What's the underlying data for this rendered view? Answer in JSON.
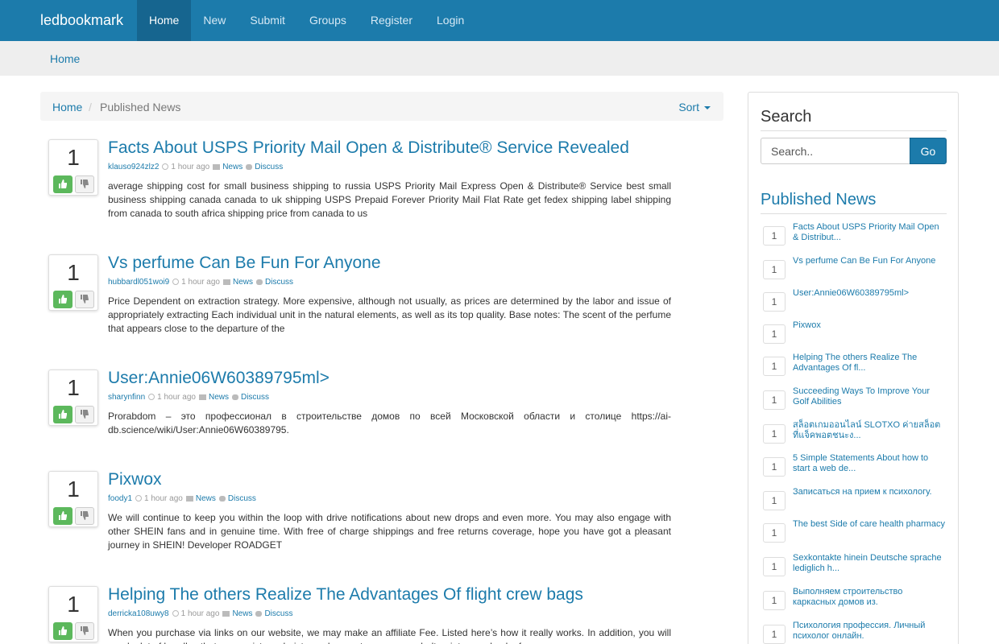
{
  "navbar": {
    "brand": "ledbookmark",
    "items": [
      {
        "label": "Home",
        "active": true
      },
      {
        "label": "New"
      },
      {
        "label": "Submit"
      },
      {
        "label": "Groups"
      },
      {
        "label": "Register"
      },
      {
        "label": "Login"
      }
    ]
  },
  "jumbotron": {
    "home_link": "Home"
  },
  "breadcrumb": {
    "home": "Home",
    "separator": "/",
    "current": "Published News",
    "sort_label": "Sort"
  },
  "posts": [
    {
      "votes": "1",
      "title": "Facts About USPS Priority Mail Open & Distribute® Service Revealed",
      "author": "klauso924zlz2",
      "time": "1 hour ago",
      "category": "News",
      "discuss": "Discuss",
      "body": "average shipping cost for small business shipping to russia USPS Priority Mail Express Open & Distribute® Service best small business shipping canada canada to uk shipping USPS Prepaid Forever Priority Mail Flat Rate get fedex shipping label shipping from canada to south africa shipping price from canada to us"
    },
    {
      "votes": "1",
      "title": "Vs perfume Can Be Fun For Anyone",
      "author": "hubbardl051woi9",
      "time": "1 hour ago",
      "category": "News",
      "discuss": "Discuss",
      "body": "Price Dependent on extraction strategy. More expensive, although not usually, as prices are determined by the labor and issue of appropriately extracting Each individual unit in the natural elements, as well as its top quality. Base notes: The scent of the perfume that appears close to the departure of the"
    },
    {
      "votes": "1",
      "title": "User:Annie06W60389795ml>",
      "author": "sharynfinn",
      "time": "1 hour ago",
      "category": "News",
      "discuss": "Discuss",
      "body": "Prorabdom – это профессионал в строительстве домов по всей Московской области и столице https://ai-db.science/wiki/User:Annie06W60389795."
    },
    {
      "votes": "1",
      "title": "Pixwox",
      "author": "foody1",
      "time": "1 hour ago",
      "category": "News",
      "discuss": "Discuss",
      "body": "We will continue to keep you within the loop with drive notifications about new drops and even more. You may also engage with other SHEIN fans and in genuine time. With free of charge shippings and free returns coverage, hope you have got a pleasant journey in SHEIN! Developer ROADGET"
    },
    {
      "votes": "1",
      "title": "Helping The others Realize The Advantages Of flight crew bags",
      "author": "derricka108uwy8",
      "time": "1 hour ago",
      "category": "News",
      "discuss": "Discuss",
      "body": "When you purchase via links on our website, we may make an affiliate Fee. Listed here’s how it really works. In addition, you will need a lot of handles that can assist you hoist your bag on to a conveyor belt or into your back of a car or"
    }
  ],
  "sidebar": {
    "search_heading": "Search",
    "search_placeholder": "Search..",
    "go_label": "Go",
    "published_heading": "Published News",
    "items": [
      {
        "count": "1",
        "title": "Facts About USPS Priority Mail Open & Distribut..."
      },
      {
        "count": "1",
        "title": "Vs perfume Can Be Fun For Anyone"
      },
      {
        "count": "1",
        "title": "User:Annie06W60389795ml>"
      },
      {
        "count": "1",
        "title": "Pixwox"
      },
      {
        "count": "1",
        "title": "Helping The others Realize The Advantages Of fl..."
      },
      {
        "count": "1",
        "title": "Succeeding Ways To Improve Your Golf Abilities"
      },
      {
        "count": "1",
        "title": "สล็อตเกมออนไลน์ SLOTXO ค่ายสล็อตที่แจ็คพอตชนะง..."
      },
      {
        "count": "1",
        "title": "5 Simple Statements About how to start a web de..."
      },
      {
        "count": "1",
        "title": "Записаться на прием к психологу."
      },
      {
        "count": "1",
        "title": "The best Side of care health pharmacy"
      },
      {
        "count": "1",
        "title": "Sexkontakte hinein Deutsche sprache lediglich h..."
      },
      {
        "count": "1",
        "title": "Выполняем строительство каркасных домов из."
      },
      {
        "count": "1",
        "title": "Психология профессия. Личный психолог онлайн."
      }
    ]
  },
  "colors": {
    "primary": "#1c7bab",
    "upvote": "#5cb85c"
  }
}
